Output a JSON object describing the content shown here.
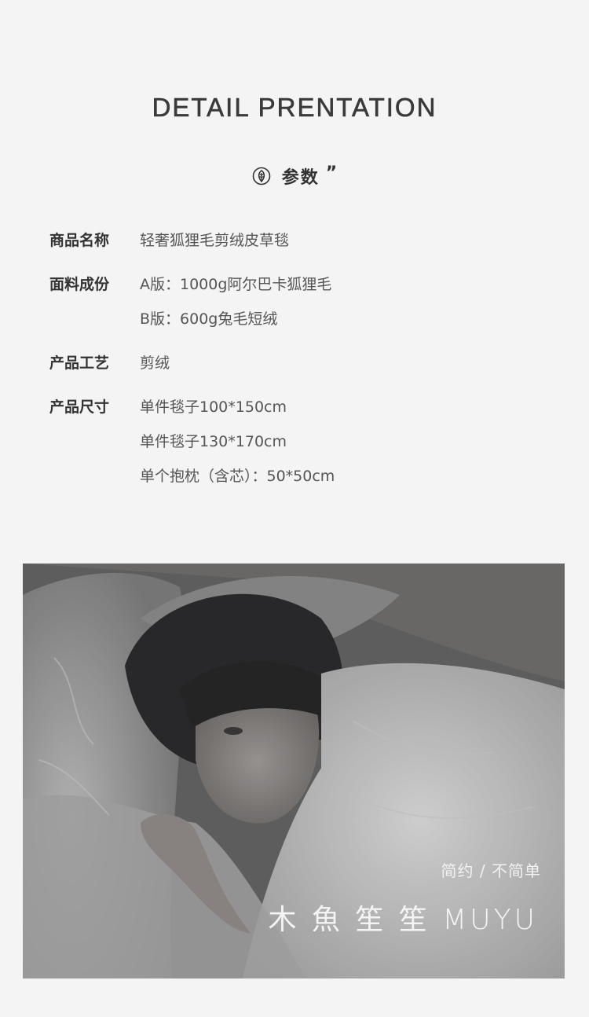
{
  "header": {
    "title": "DETAIL PRENTATION"
  },
  "section": {
    "icon": "leaf-icon",
    "label": "参数",
    "quote": "”"
  },
  "params": [
    {
      "key": "商品名称",
      "values": [
        "轻奢狐狸毛剪绒皮草毯"
      ]
    },
    {
      "key": "面料成份",
      "values": [
        "A版：1000g阿尔巴卡狐狸毛",
        "B版：600g兔毛短绒"
      ]
    },
    {
      "key": "产品工艺",
      "values": [
        "剪绒"
      ]
    },
    {
      "key": "产品尺寸",
      "values": [
        "单件毯子100*150cm",
        "单件毯子130*170cm",
        "单个抱枕（含芯）：50*50cm"
      ]
    }
  ],
  "photo": {
    "tagline": "简约 / 不简单",
    "brand": "木 魚 笙 笙 MUYU"
  }
}
